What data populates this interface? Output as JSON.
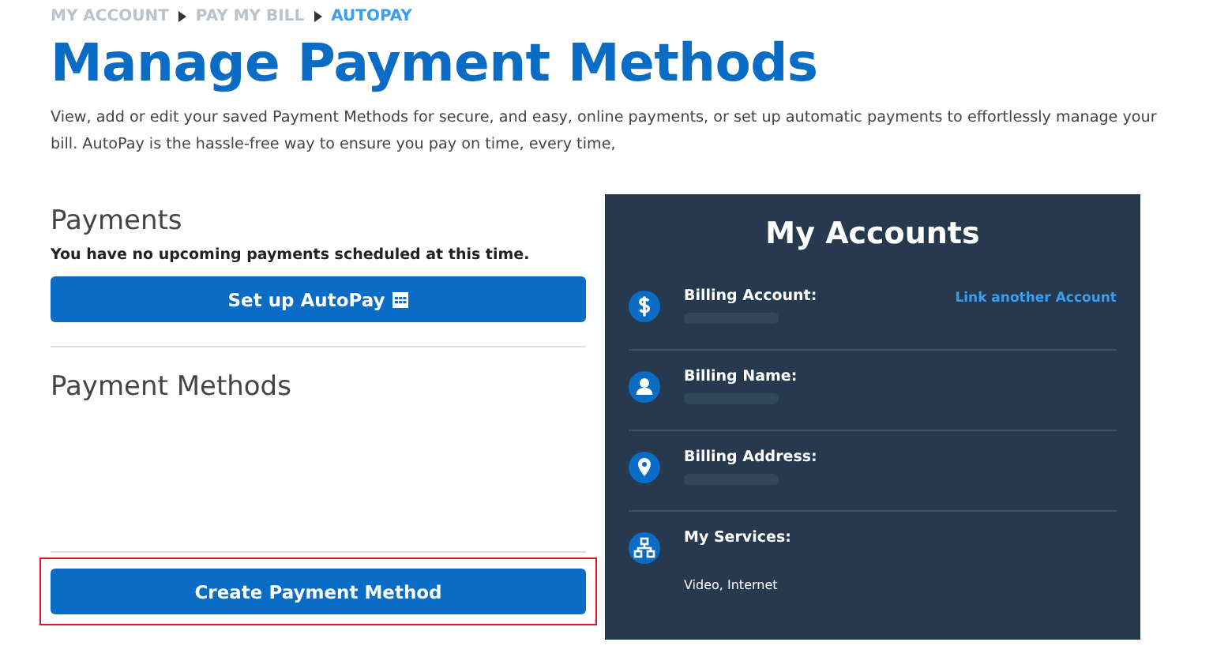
{
  "breadcrumb": [
    {
      "label": "MY ACCOUNT",
      "selected": false
    },
    {
      "label": "PAY MY BILL",
      "selected": false
    },
    {
      "label": "AUTOPAY",
      "selected": true
    }
  ],
  "title": "Manage Payment Methods",
  "description": "View, add or edit your saved Payment Methods for secure, and easy, online payments, or set up automatic payments to effortlessly manage your bill. AutoPay is the hassle-free way to ensure you pay on time, every time,",
  "payments": {
    "heading": "Payments",
    "message": "You have no upcoming payments scheduled at this time.",
    "button": "Set up AutoPay"
  },
  "payment_methods": {
    "heading": "Payment Methods",
    "button": "Create Payment Method",
    "highlighted": true
  },
  "accounts": {
    "title": "My Accounts",
    "link": "Link another Account",
    "rows": [
      {
        "kind": "dollar",
        "label": "Billing Account:"
      },
      {
        "kind": "person",
        "label": "Billing Name:"
      },
      {
        "kind": "pin",
        "label": "Billing Address:"
      },
      {
        "kind": "network",
        "label": "My Services:",
        "detail": "Video, Internet"
      }
    ]
  }
}
